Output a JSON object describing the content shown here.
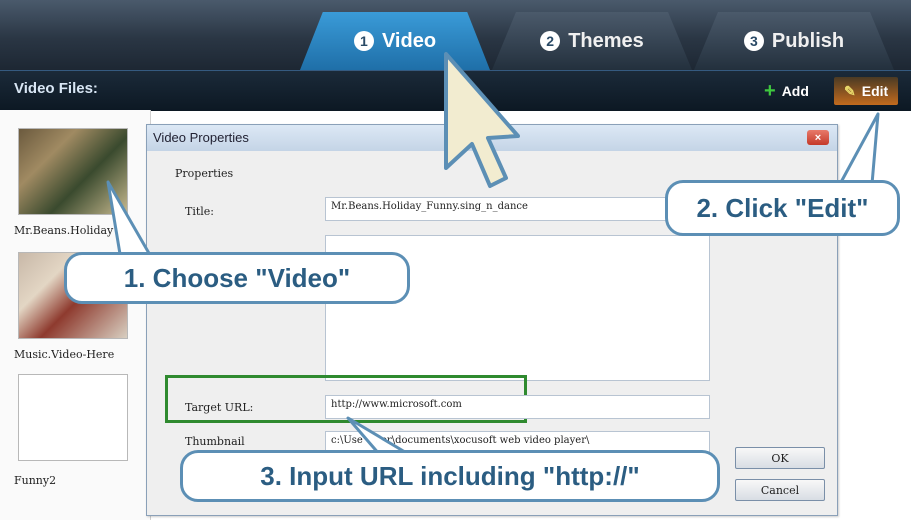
{
  "tabs": [
    {
      "num": "1",
      "label": "Video",
      "active": true
    },
    {
      "num": "2",
      "label": "Themes",
      "active": false
    },
    {
      "num": "3",
      "label": "Publish",
      "active": false
    }
  ],
  "toolbar": {
    "section_label": "Video Files:",
    "add_label": "Add",
    "edit_label": "Edit"
  },
  "files": [
    {
      "name": "Mr.Beans.Holiday"
    },
    {
      "name": "Music.Video-Here"
    },
    {
      "name": "Funny2"
    }
  ],
  "dialog": {
    "title": "Video Properties",
    "close_label": "×",
    "group_label": "Properties",
    "title_label": "Title:",
    "title_value": "Mr.Beans.Holiday_Funny.sing_n_dance",
    "target_url_label": "Target URL:",
    "target_url_value": "http://www.microsoft.com",
    "thumbnail_label": "Thumbnail",
    "thumbnail_value": "c:\\Use    wner\\documents\\xocusoft web video player\\",
    "ok_label": "OK",
    "cancel_label": "Cancel"
  },
  "callouts": {
    "choose_video": "1. Choose \"Video\"",
    "click_edit": "2. Click \"Edit\"",
    "input_url": "3. Input URL including \"http://\""
  },
  "colors": {
    "callout_border": "#5c8fb5",
    "callout_text": "#2b5d82",
    "highlight_green": "#2f8a2f",
    "active_tab": "#2a86c6"
  }
}
